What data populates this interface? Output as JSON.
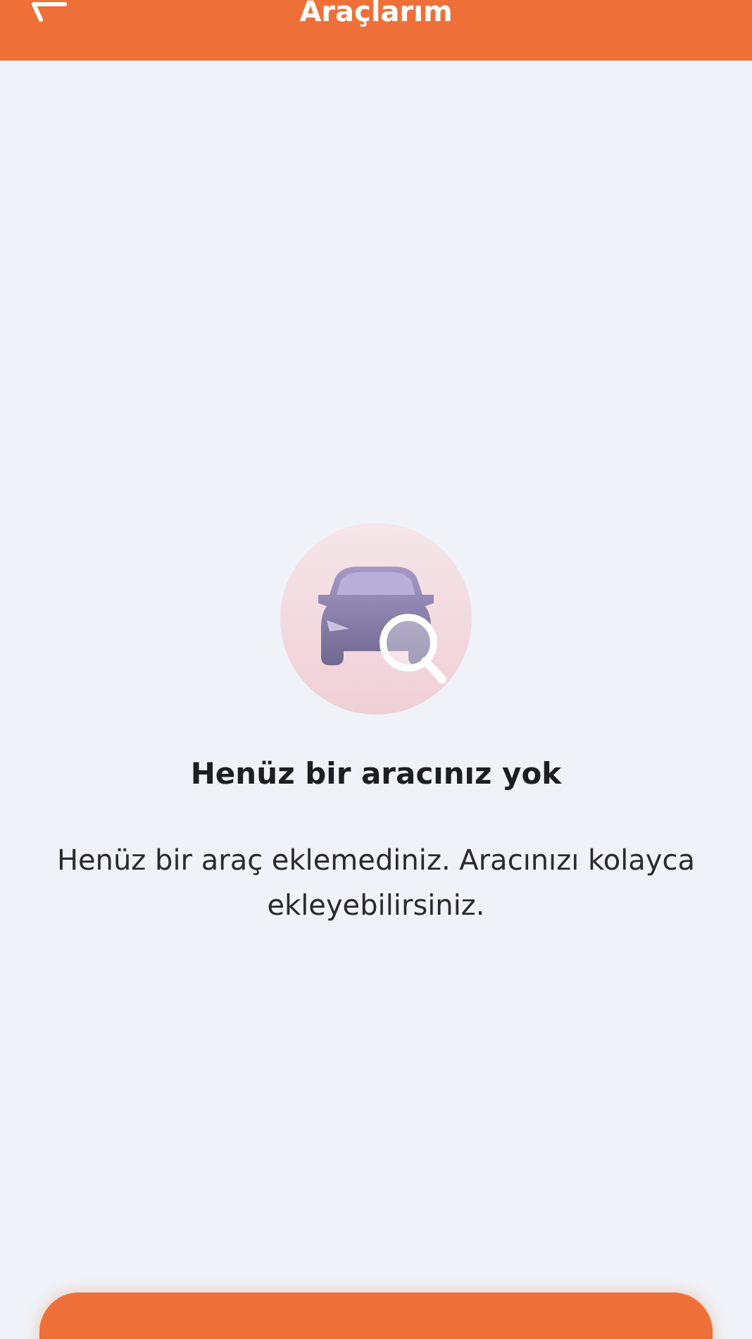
{
  "header": {
    "title": "Araçlarım"
  },
  "empty_state": {
    "title": "Henüz bir aracınız yok",
    "message": "Henüz bir araç eklemediniz. Aracınızı kolayca ekleyebilirsiniz."
  },
  "bottom_button": {
    "kind": "primary"
  }
}
